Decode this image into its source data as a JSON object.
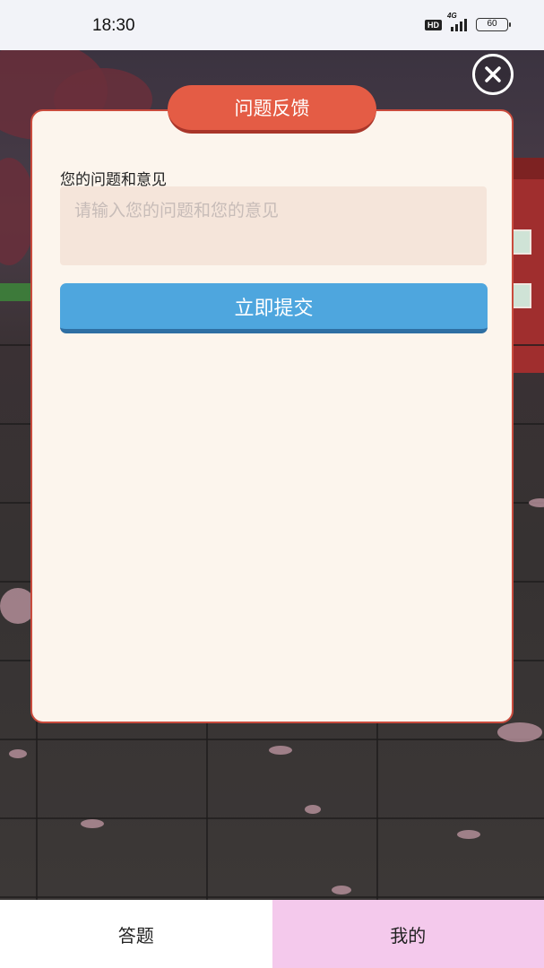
{
  "status_bar": {
    "time": "18:30",
    "network_badge": "HD",
    "network_type": "4G",
    "battery": "60"
  },
  "dialog": {
    "title": "问题反馈",
    "field_label": "您的问题和意见",
    "input_placeholder": "请输入您的问题和您的意见",
    "input_value": "",
    "submit_label": "立即提交"
  },
  "bottom_nav": {
    "tabs": [
      {
        "label": "答题",
        "selected": false
      },
      {
        "label": "我的",
        "selected": true
      }
    ],
    "selected_color": "#f4c9ec"
  },
  "colors": {
    "title_pill": "#e45c45",
    "submit_button": "#4ea6de",
    "dialog_background": "#fcf5ed"
  },
  "icons": {
    "close": "close-icon"
  }
}
